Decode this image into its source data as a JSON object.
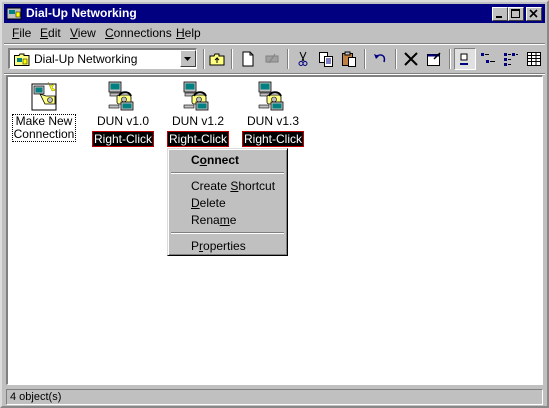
{
  "window": {
    "title": "Dial-Up Networking",
    "title_bar_color": "#000080"
  },
  "menubar": {
    "items": [
      {
        "label": "File",
        "mnemonic": "F"
      },
      {
        "label": "Edit",
        "mnemonic": "E"
      },
      {
        "label": "View",
        "mnemonic": "V"
      },
      {
        "label": "Connections",
        "mnemonic": "C"
      },
      {
        "label": "Help",
        "mnemonic": "H"
      }
    ]
  },
  "toolbar": {
    "address": "Dial-Up Networking",
    "buttons": [
      "up-one-level-icon",
      "map-network-drive-icon",
      "disconnect-drive-icon",
      "cut-icon",
      "copy-icon",
      "paste-icon",
      "undo-icon",
      "delete-icon",
      "properties-icon",
      "large-icons-icon",
      "small-icons-icon",
      "list-icon",
      "details-icon"
    ]
  },
  "items": [
    {
      "label_line1": "Make New",
      "label_line2": "Connection"
    },
    {
      "label": "DUN v1.0",
      "badge": "Right-Click"
    },
    {
      "label": "DUN v1.2",
      "badge": "Right-Click"
    },
    {
      "label": "DUN v1.3",
      "badge": "Right-Click"
    }
  ],
  "context_menu": {
    "items": [
      "Connect",
      "Create Shortcut",
      "Delete",
      "Rename",
      "Properties"
    ]
  },
  "statusbar": {
    "text": "4 object(s)"
  }
}
